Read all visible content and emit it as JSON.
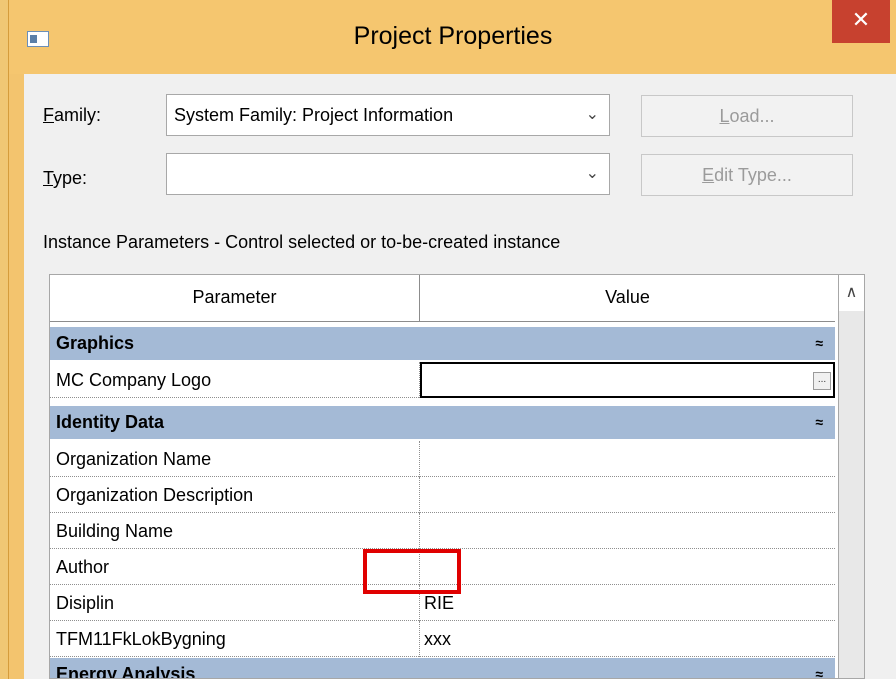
{
  "window": {
    "title": "Project Properties",
    "close_label": "✕"
  },
  "family": {
    "label": "Family:",
    "mnemonic": "F",
    "rest": "amily:",
    "value": "System Family: Project Information",
    "arrow": "⌄"
  },
  "type": {
    "label": "Type:",
    "mnemonic": "T",
    "rest": "ype:",
    "value": "",
    "arrow": "⌄"
  },
  "buttons": {
    "load_mn": "L",
    "load_rest": "oad...",
    "edit_mn": "E",
    "edit_rest": "dit Type..."
  },
  "instance_label": "Instance Parameters - Control selected or to-be-created instance",
  "grid": {
    "col_parameter": "Parameter",
    "col_value": "Value",
    "groups": [
      {
        "name": "Graphics",
        "chevron": "≈"
      },
      {
        "name": "Identity Data",
        "chevron": "≈"
      },
      {
        "name": "Energy Analysis",
        "chevron": "≈"
      }
    ],
    "rows": {
      "mc_company_logo": {
        "param": "MC Company Logo",
        "value": "",
        "ellipsis": "..."
      },
      "organization_name": {
        "param": "Organization Name",
        "value": ""
      },
      "organization_description": {
        "param": "Organization Description",
        "value": ""
      },
      "building_name": {
        "param": "Building Name",
        "value": ""
      },
      "author": {
        "param": "Author",
        "value": ""
      },
      "disiplin": {
        "param": "Disiplin",
        "value": "RIE"
      },
      "tfm": {
        "param": "TFM11FkLokBygning",
        "value": "xxx"
      }
    }
  },
  "scroll_up": "∧"
}
